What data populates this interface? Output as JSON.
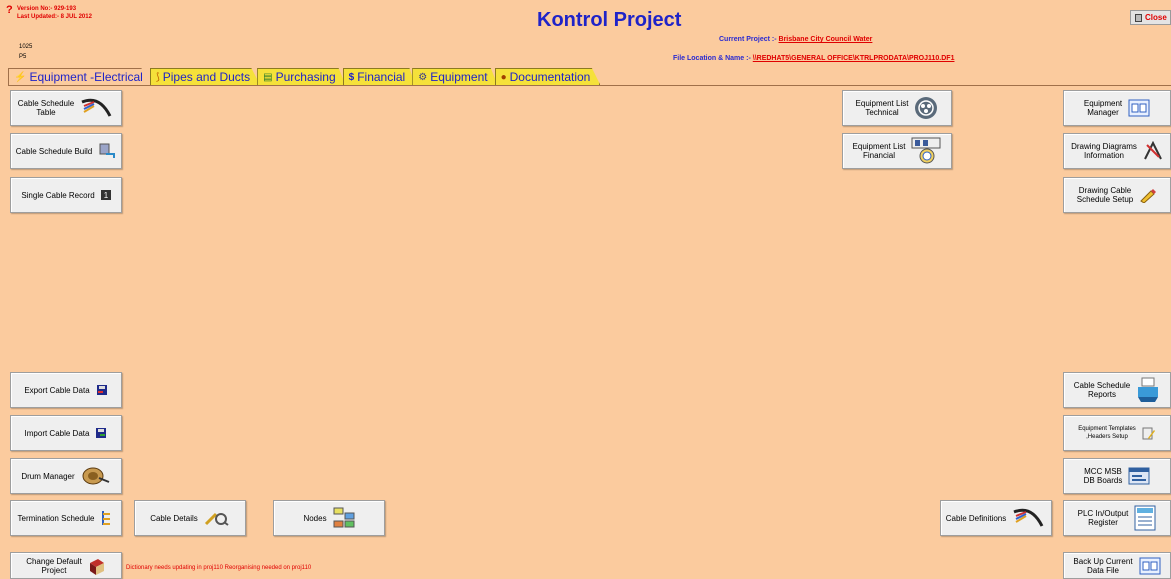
{
  "header": {
    "version_label": "Version No:-",
    "version_value": "929-193",
    "updated_label": "Last Updated:-",
    "updated_value": "8 JUL 2012",
    "code1": "1025",
    "code2": "P5",
    "title": "Kontrol Project",
    "current_project_label": "Current Project :-",
    "current_project_value": "Brisbane City Council  Water",
    "file_location_label": "File Location & Name :-",
    "file_location_value": "\\\\REDHAT5\\GENERAL OFFICE\\KTRLPRODATA\\PROJ110.DF1",
    "close_label": "Close"
  },
  "tabs": [
    {
      "label": "Equipment -Electrical",
      "icon": "lightning-icon"
    },
    {
      "label": "Pipes and Ducts",
      "icon": "pipes-icon"
    },
    {
      "label": "Purchasing",
      "icon": "purchasing-icon"
    },
    {
      "label": "Financial",
      "icon": "dollar-icon"
    },
    {
      "label": "Equipment",
      "icon": "equipment-icon"
    },
    {
      "label": "Documentation",
      "icon": "documentation-icon"
    }
  ],
  "buttons": {
    "cable_schedule_table": "Cable Schedule\nTable",
    "cable_schedule_build": "Cable Schedule Build",
    "single_cable_record": "Single Cable Record",
    "export_cable_data": "Export Cable Data",
    "import_cable_data": "Import Cable Data",
    "drum_manager": "Drum Manager",
    "termination_schedule": "Termination Schedule",
    "cable_details": "Cable Details",
    "nodes": "Nodes",
    "change_default_project": "Change Default\nProject",
    "equipment_list_technical": "Equipment List\nTechnical",
    "equipment_list_financial": "Equipment List\nFinancial",
    "cable_definitions": "Cable Definitions",
    "equipment_manager": "Equipment\nManager",
    "drawing_diagrams_information": "Drawing Diagrams\nInformation",
    "drawing_cable_schedule_setup": "Drawing Cable\nSchedule Setup",
    "cable_schedule_reports": "Cable Schedule\nReports",
    "equipment_templates_headers_setup": "Equipment Templates\n,Headers Setup",
    "mcc_msb_db_boards": "MCC MSB\nDB Boards",
    "plc_io_register": "PLC In/Output\nRegister",
    "back_up_current_data_file": "Back Up Current\nData File"
  },
  "status_message": "Dictionary needs updating in proj110  Reorganising needed on proj110",
  "colors": {
    "background": "#FBCB9E",
    "title": "#1F23C8",
    "alert": "#E00000",
    "tab": "#F5E13A"
  }
}
